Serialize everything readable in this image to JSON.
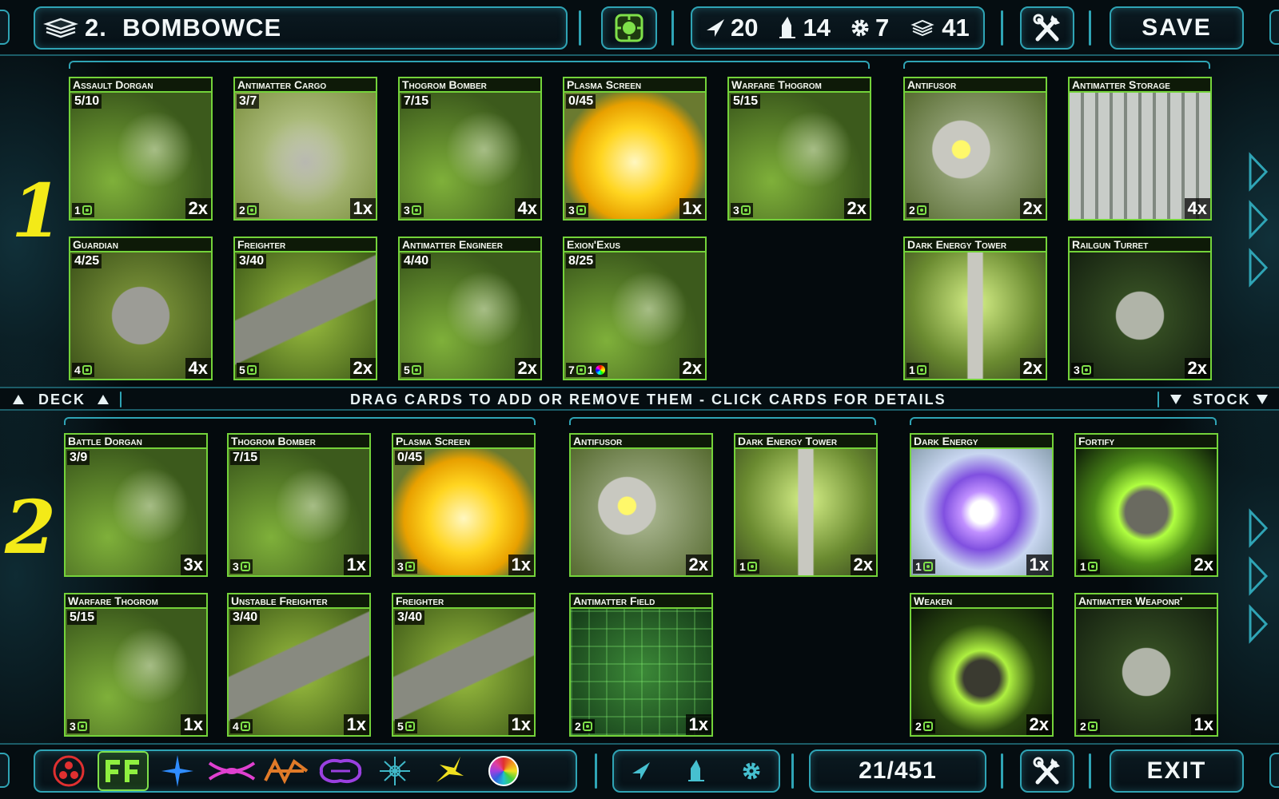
{
  "header": {
    "deck_title": "2.  BOMBOWCE",
    "stats": [
      {
        "icon": "ship-icon",
        "value": "20"
      },
      {
        "icon": "building-icon",
        "value": "14"
      },
      {
        "icon": "gear-icon",
        "value": "7"
      },
      {
        "icon": "cards-icon",
        "value": "41"
      }
    ],
    "save_label": "SAVE"
  },
  "deck": {
    "row_label": "1",
    "cards": [
      {
        "name": "Assault Dorgan",
        "hp": "5/10",
        "cost": "1",
        "count": "2x",
        "art": "ship"
      },
      {
        "name": "Antimatter Cargo",
        "hp": "3/7",
        "cost": "2",
        "count": "1x",
        "art": "cargo"
      },
      {
        "name": "Thogrom Bomber",
        "hp": "7/15",
        "cost": "3",
        "count": "4x",
        "art": "ship"
      },
      {
        "name": "Plasma Screen",
        "hp": "0/45",
        "cost": "3",
        "count": "1x",
        "art": "plasma"
      },
      {
        "name": "Warfare Thogrom",
        "hp": "5/15",
        "cost": "3",
        "count": "2x",
        "art": "ship"
      },
      {
        "name": "Antifusor",
        "hp": "",
        "cost": "2",
        "count": "2x",
        "art": "station"
      },
      {
        "name": "Antimatter Storage",
        "hp": "",
        "cost": "",
        "count": "4x",
        "art": "storage"
      },
      {
        "name": "Guardian",
        "hp": "4/25",
        "cost": "4",
        "count": "4x",
        "art": "guardian"
      },
      {
        "name": "Freighter",
        "hp": "3/40",
        "cost": "5",
        "count": "2x",
        "art": "freighter"
      },
      {
        "name": "Antimatter Engineer",
        "hp": "4/40",
        "cost": "5",
        "count": "2x",
        "art": "ship"
      },
      {
        "name": "Exion'Exus",
        "hp": "8/25",
        "cost": "7",
        "cost2": "1",
        "count": "2x",
        "art": "ship"
      },
      {
        "name": "Dark Energy Tower",
        "hp": "",
        "cost": "1",
        "count": "2x",
        "art": "tower"
      },
      {
        "name": "Railgun Turret",
        "hp": "",
        "cost": "3",
        "count": "2x",
        "art": "turret"
      }
    ]
  },
  "divider": {
    "deck_label": "DECK",
    "instructions": "DRAG CARDS TO ADD OR REMOVE THEM - CLICK CARDS FOR DETAILS",
    "stock_label": "STOCK"
  },
  "stock": {
    "row_label": "2",
    "cards": [
      {
        "name": "Battle Dorgan",
        "hp": "3/9",
        "cost": "",
        "count": "3x",
        "art": "ship"
      },
      {
        "name": "Thogrom Bomber",
        "hp": "7/15",
        "cost": "3",
        "count": "1x",
        "art": "ship"
      },
      {
        "name": "Plasma Screen",
        "hp": "0/45",
        "cost": "3",
        "count": "1x",
        "art": "plasma"
      },
      {
        "name": "Antifusor",
        "hp": "",
        "cost": "",
        "count": "2x",
        "art": "station"
      },
      {
        "name": "Dark Energy Tower",
        "hp": "",
        "cost": "1",
        "count": "2x",
        "art": "tower"
      },
      {
        "name": "Dark Energy",
        "hp": "",
        "cost": "1",
        "count": "1x",
        "art": "vortex"
      },
      {
        "name": "Fortify",
        "hp": "",
        "cost": "1",
        "count": "2x",
        "art": "shield"
      },
      {
        "name": "Warfare Thogrom",
        "hp": "5/15",
        "cost": "3",
        "count": "1x",
        "art": "ship"
      },
      {
        "name": "Unstable Freighter",
        "hp": "3/40",
        "cost": "4",
        "count": "1x",
        "art": "freighter"
      },
      {
        "name": "Freighter",
        "hp": "3/40",
        "cost": "5",
        "count": "1x",
        "art": "freighter"
      },
      {
        "name": "Antimatter Field",
        "hp": "",
        "cost": "2",
        "count": "1x",
        "art": "field"
      },
      {
        "name": "Weaken",
        "hp": "",
        "cost": "2",
        "count": "2x",
        "art": "weaken"
      },
      {
        "name": "Antimatter Weaponr'",
        "hp": "",
        "cost": "2",
        "count": "1x",
        "art": "turret"
      }
    ]
  },
  "footer": {
    "factions": [
      "red-faction-icon",
      "green-faction-icon",
      "blue-star-icon",
      "magenta-faction-icon",
      "orange-faction-icon",
      "purple-faction-icon",
      "teal-network-icon",
      "yellow-burst-icon",
      "rainbow-wheel-icon"
    ],
    "filters": [
      "ship-icon",
      "building-icon",
      "gear-icon"
    ],
    "card_count": "21/451",
    "exit_label": "EXIT"
  },
  "colors": {
    "frame": "#2fa4b5",
    "card_border": "#74d33a",
    "row_number": "#f3ea18"
  }
}
